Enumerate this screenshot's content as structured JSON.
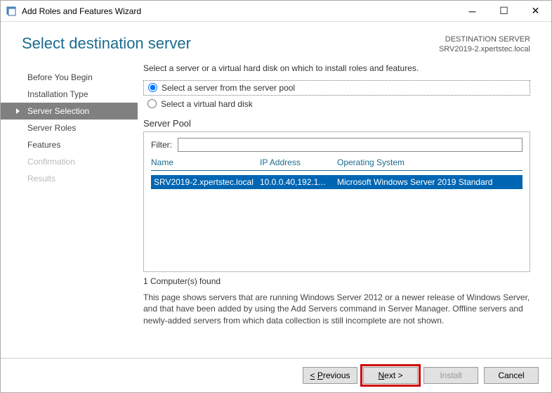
{
  "titlebar": {
    "text": "Add Roles and Features Wizard"
  },
  "header": {
    "title": "Select destination server",
    "dest_label": "DESTINATION SERVER",
    "dest_value": "SRV2019-2.xpertstec.local"
  },
  "sidebar": {
    "items": [
      {
        "label": "Before You Begin"
      },
      {
        "label": "Installation Type"
      },
      {
        "label": "Server Selection"
      },
      {
        "label": "Server Roles"
      },
      {
        "label": "Features"
      },
      {
        "label": "Confirmation"
      },
      {
        "label": "Results"
      }
    ]
  },
  "main": {
    "instruction": "Select a server or a virtual hard disk on which to install roles and features.",
    "radio1": "Select a server from the server pool",
    "radio2": "Select a virtual hard disk",
    "pool_title": "Server Pool",
    "filter_label": "Filter:",
    "columns": {
      "name": "Name",
      "ip": "IP Address",
      "os": "Operating System"
    },
    "rows": [
      {
        "name": "SRV2019-2.xpertstec.local",
        "ip": "10.0.0.40,192.1...",
        "os": "Microsoft Windows Server 2019 Standard"
      }
    ],
    "count": "1 Computer(s) found",
    "description": "This page shows servers that are running Windows Server 2012 or a newer release of Windows Server, and that have been added by using the Add Servers command in Server Manager. Offline servers and newly-added servers from which data collection is still incomplete are not shown."
  },
  "footer": {
    "previous": "< Previous",
    "next": "Next >",
    "install": "Install",
    "cancel": "Cancel"
  }
}
